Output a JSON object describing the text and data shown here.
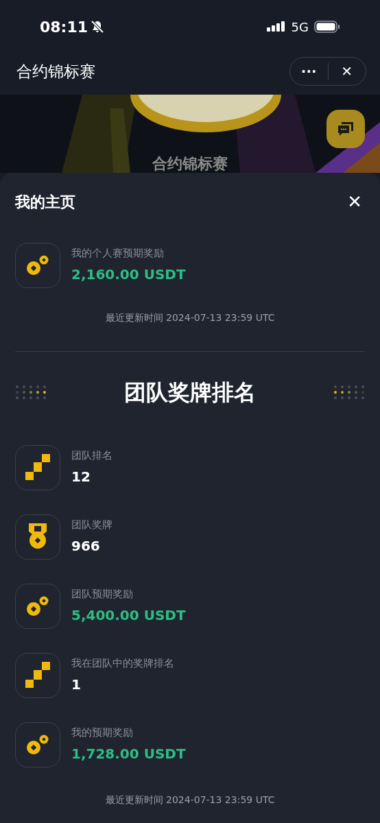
{
  "status_bar": {
    "time": "08:11",
    "silent": true,
    "network": "5G"
  },
  "header": {
    "title": "合约锦标赛",
    "more_label": "···",
    "close_label": "✕"
  },
  "banner": {
    "title": "合约锦标赛"
  },
  "sheet": {
    "title": "我的主页",
    "close_label": "✕",
    "personal": [
      {
        "kind": "coin",
        "label": "我的个人赛预期奖励",
        "value": "2,160.00 USDT",
        "highlight": true
      }
    ],
    "personal_updated": "最近更新时间 2024-07-13 23:59 UTC",
    "team_title": "团队奖牌排名",
    "team": [
      {
        "kind": "rank",
        "label": "团队排名",
        "value": "12",
        "highlight": false
      },
      {
        "kind": "medal",
        "label": "团队奖牌",
        "value": "966",
        "highlight": false
      },
      {
        "kind": "coin",
        "label": "团队预期奖励",
        "value": "5,400.00 USDT",
        "highlight": true
      },
      {
        "kind": "rank",
        "label": "我在团队中的奖牌排名",
        "value": "1",
        "highlight": false
      },
      {
        "kind": "coin",
        "label": "我的预期奖励",
        "value": "1,728.00 USDT",
        "highlight": true
      }
    ],
    "team_updated": "最近更新时间 2024-07-13 23:59 UTC"
  }
}
